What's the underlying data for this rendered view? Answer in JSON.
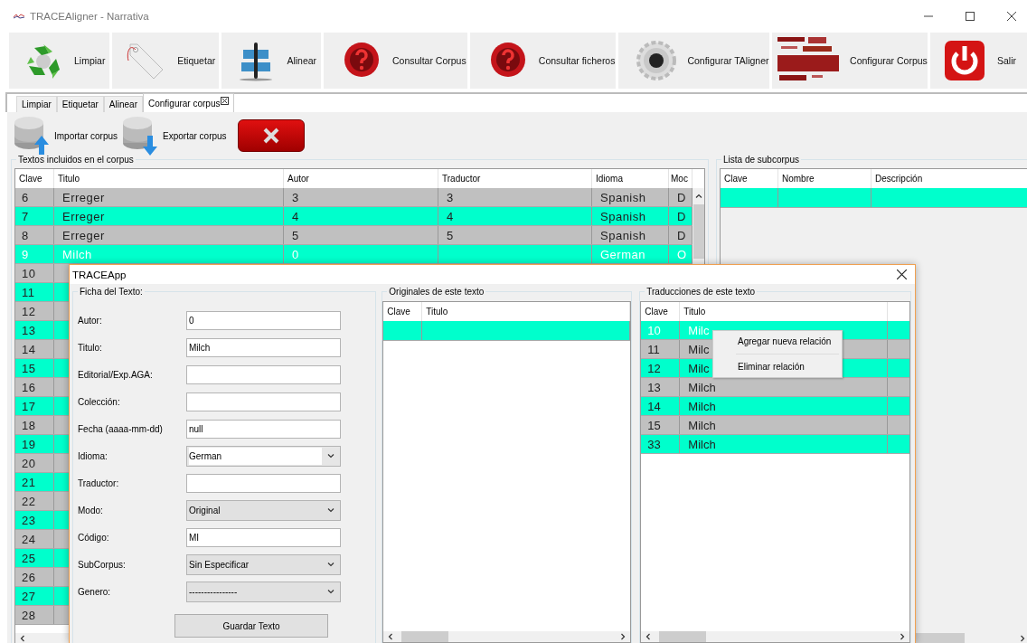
{
  "window": {
    "title": "TRACEAligner - Narrativa"
  },
  "toolbar": [
    {
      "label": "Limpiar",
      "kind": "recycle"
    },
    {
      "label": "Etiquetar",
      "kind": "tag"
    },
    {
      "label": "Alinear",
      "kind": "align"
    },
    {
      "label": "Consultar Corpus",
      "kind": "question"
    },
    {
      "label": "Consultar ficheros",
      "kind": "question"
    },
    {
      "label": "Configurar TAligner",
      "kind": "gear"
    },
    {
      "label": "Configurar Corpus",
      "kind": "cloud"
    },
    {
      "label": "Salir",
      "kind": "power"
    }
  ],
  "tabs": [
    {
      "label": "Limpiar",
      "selected": false,
      "closable": false
    },
    {
      "label": "Etiquetar",
      "selected": false,
      "closable": false
    },
    {
      "label": "Alinear",
      "selected": false,
      "closable": false
    },
    {
      "label": "Configurar corpus",
      "selected": true,
      "closable": true
    }
  ],
  "actions": [
    {
      "label": "Importar corpus",
      "kind": "import"
    },
    {
      "label": "Exportar corpus",
      "kind": "export"
    },
    {
      "kind": "delete"
    }
  ],
  "corpus_texts": {
    "title": "Textos incluidos en el corpus",
    "columns": [
      "Clave",
      "Titulo",
      "Autor",
      "Traductor",
      "Idioma",
      "Moc"
    ],
    "rows": [
      {
        "cells": [
          "6",
          "Erreger",
          "3",
          "3",
          "Spanish",
          "D"
        ],
        "selected": false,
        "color": "#c0c0c0"
      },
      {
        "cells": [
          "7",
          "Erreger",
          "4",
          "4",
          "Spanish",
          "D"
        ],
        "selected": false,
        "color": "#00ffcc"
      },
      {
        "cells": [
          "8",
          "Erreger",
          "5",
          "5",
          "Spanish",
          "D"
        ],
        "selected": false,
        "color": "#c0c0c0"
      },
      {
        "cells": [
          "9",
          "Milch",
          "0",
          "",
          "German",
          "O"
        ],
        "selected": true,
        "color": "#00ffcc"
      },
      {
        "cells": [
          "10"
        ],
        "selected": false,
        "color": "#c0c0c0"
      },
      {
        "cells": [
          "11"
        ],
        "selected": false,
        "color": "#00ffcc"
      },
      {
        "cells": [
          "12"
        ],
        "selected": false,
        "color": "#c0c0c0"
      },
      {
        "cells": [
          "13"
        ],
        "selected": false,
        "color": "#00ffcc"
      },
      {
        "cells": [
          "14"
        ],
        "selected": false,
        "color": "#c0c0c0"
      },
      {
        "cells": [
          "15"
        ],
        "selected": false,
        "color": "#00ffcc"
      },
      {
        "cells": [
          "16"
        ],
        "selected": false,
        "color": "#c0c0c0"
      },
      {
        "cells": [
          "17"
        ],
        "selected": false,
        "color": "#00ffcc"
      },
      {
        "cells": [
          "18"
        ],
        "selected": false,
        "color": "#c0c0c0"
      },
      {
        "cells": [
          "19"
        ],
        "selected": false,
        "color": "#00ffcc"
      },
      {
        "cells": [
          "20"
        ],
        "selected": false,
        "color": "#c0c0c0"
      },
      {
        "cells": [
          "21"
        ],
        "selected": false,
        "color": "#00ffcc"
      },
      {
        "cells": [
          "22"
        ],
        "selected": false,
        "color": "#c0c0c0"
      },
      {
        "cells": [
          "23"
        ],
        "selected": false,
        "color": "#00ffcc"
      },
      {
        "cells": [
          "24"
        ],
        "selected": false,
        "color": "#c0c0c0"
      },
      {
        "cells": [
          "25"
        ],
        "selected": false,
        "color": "#00ffcc"
      },
      {
        "cells": [
          "26"
        ],
        "selected": false,
        "color": "#c0c0c0"
      },
      {
        "cells": [
          "27"
        ],
        "selected": false,
        "color": "#00ffcc"
      },
      {
        "cells": [
          "28"
        ],
        "selected": false,
        "color": "#c0c0c0"
      }
    ]
  },
  "subcorpus": {
    "title": "Lista de subcorpus",
    "columns": [
      "Clave",
      "Nombre",
      "Descripción"
    ],
    "rows": [
      {
        "color": "#00ffcc"
      }
    ]
  },
  "dialog": {
    "title": "TRACEApp",
    "form": {
      "title": "Ficha del Texto:",
      "fields": [
        {
          "label": "Autor:",
          "kind": "text",
          "value": "0"
        },
        {
          "label": "Titulo:",
          "kind": "text",
          "value": "Milch"
        },
        {
          "label": "Editorial/Exp.AGA:",
          "kind": "text"
        },
        {
          "label": "Colección:",
          "kind": "text"
        },
        {
          "label": "Fecha (aaaa-mm-dd)",
          "kind": "text",
          "value": "null"
        },
        {
          "label": "Idioma:",
          "kind": "combo",
          "value": "German"
        },
        {
          "label": "Traductor:",
          "kind": "text"
        },
        {
          "label": "Modo:",
          "kind": "select",
          "value": "Original"
        },
        {
          "label": "Código:",
          "kind": "text",
          "value": "MI"
        },
        {
          "label": "SubCorpus:",
          "kind": "select",
          "value": "Sin Especificar"
        },
        {
          "label": "Genero:",
          "kind": "select",
          "value": "----------------"
        }
      ],
      "save_button": "Guardar Texto"
    },
    "originals": {
      "title": "Originales de este texto",
      "columns": [
        "Clave",
        "Titulo"
      ],
      "rows": [
        {
          "color": "#00ffcc"
        }
      ]
    },
    "translations": {
      "title": "Traducciones de este texto",
      "columns": [
        "Clave",
        "Titulo"
      ],
      "rows": [
        {
          "cells": [
            "10",
            "Milc"
          ],
          "selected": true,
          "color": "#00ffcc"
        },
        {
          "cells": [
            "11",
            "Milc"
          ],
          "selected": false,
          "color": "#c0c0c0"
        },
        {
          "cells": [
            "12",
            "Milc"
          ],
          "selected": false,
          "color": "#00ffcc"
        },
        {
          "cells": [
            "13",
            "Milch"
          ],
          "selected": false,
          "color": "#c0c0c0"
        },
        {
          "cells": [
            "14",
            "Milch"
          ],
          "selected": false,
          "color": "#00ffcc"
        },
        {
          "cells": [
            "15",
            "Milch"
          ],
          "selected": false,
          "color": "#c0c0c0"
        },
        {
          "cells": [
            "33",
            "Milch"
          ],
          "selected": false,
          "color": "#00ffcc"
        }
      ]
    }
  },
  "context_menu": {
    "items": [
      "Agregar nueva relación",
      "Eliminar relación"
    ]
  }
}
